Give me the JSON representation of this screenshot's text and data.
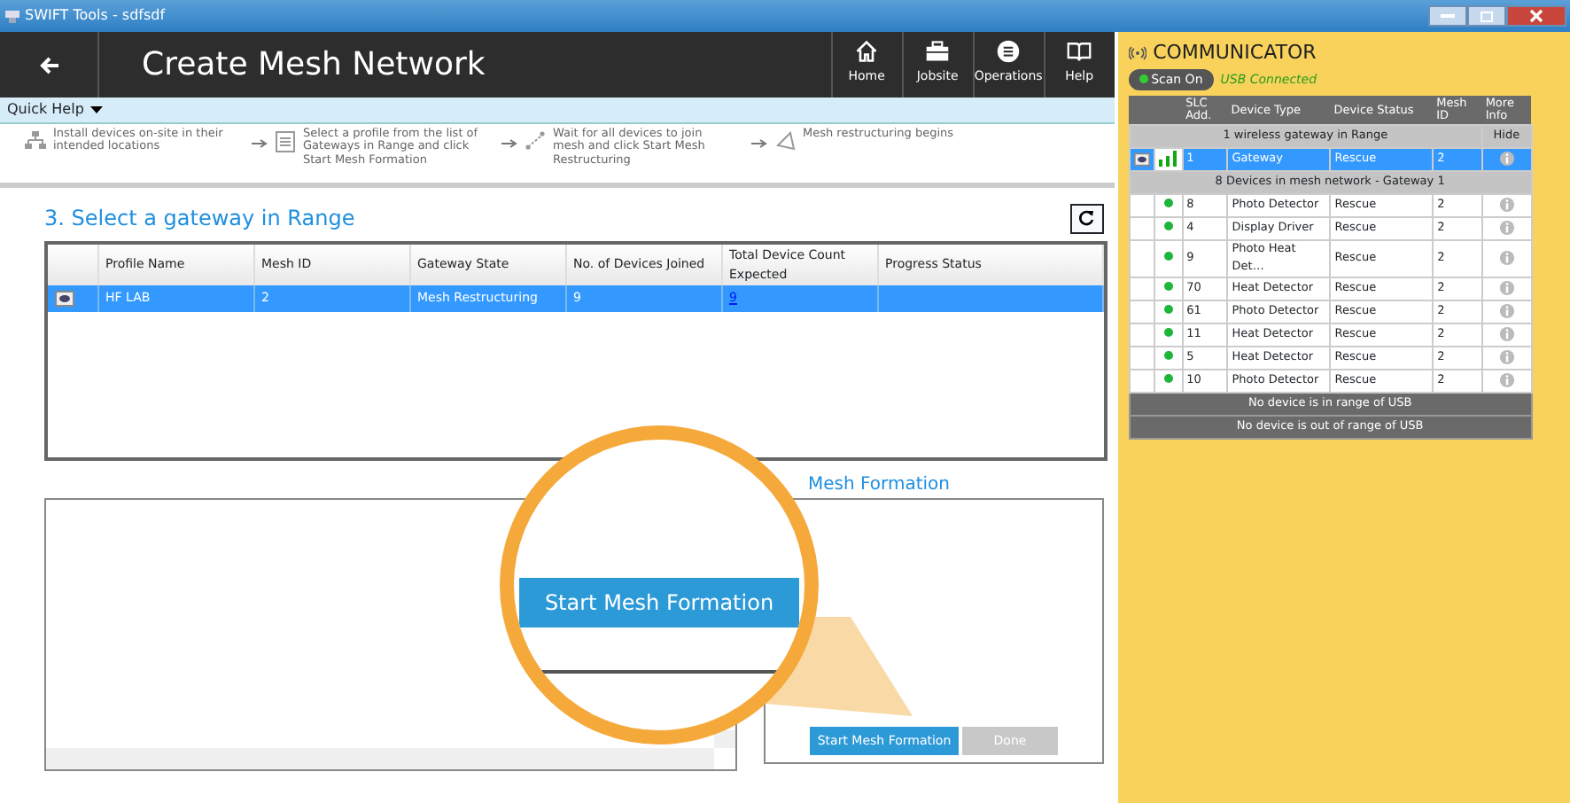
{
  "window": {
    "title": "SWIFT Tools - sdfsdf"
  },
  "header": {
    "title": "Create Mesh Network",
    "nav": [
      {
        "kind": "home",
        "label": "Home"
      },
      {
        "kind": "jobsite",
        "label": "Jobsite"
      },
      {
        "kind": "operations",
        "label": "Operations"
      },
      {
        "kind": "help",
        "label": "Help"
      }
    ]
  },
  "quick_help": {
    "label": "Quick Help",
    "steps": [
      {
        "kind": "devices",
        "text": "Install devices on-site in their intended locations"
      },
      {
        "kind": "list",
        "text": "Select a profile from the list of Gateways in Range and click Start Mesh Formation"
      },
      {
        "kind": "join",
        "text": "Wait for all devices to join mesh and click Start Mesh Restructuring"
      },
      {
        "kind": "mesh",
        "text": "Mesh restructuring begins"
      }
    ]
  },
  "gateway_section": {
    "title": "3. Select a gateway in Range",
    "table": {
      "columns": [
        "Profile Name",
        "Mesh ID",
        "Gateway State",
        "No. of Devices Joined",
        "Total Device Count Expected",
        "Progress Status"
      ],
      "rows": [
        {
          "selected": true,
          "profile_name": "HF LAB",
          "mesh_id": "2",
          "gateway_state": "Mesh Restructuring",
          "devices_joined": "9",
          "total_expected": "9"
        }
      ]
    }
  },
  "mesh_formation": {
    "title": "Mesh Formation",
    "buttons": [
      {
        "label": "Start Mesh Formation",
        "disabled": false
      },
      {
        "label": "Done",
        "disabled": true
      }
    ]
  },
  "magnifier": {
    "button_label": "Start Mesh Formation"
  },
  "communicator": {
    "title": "COMMUNICATOR",
    "scan_button": {
      "label": "Scan On",
      "on": true
    },
    "usb_status": "USB Connected",
    "columns": [
      "SLC Add.",
      "Device Type",
      "Device Status",
      "Mesh ID",
      "More Info"
    ],
    "gateway_group": "1 wireless gateway in Range",
    "hide_label": "Hide",
    "gateways": [
      {
        "selected": true,
        "slc": "1",
        "device_type": "Gateway",
        "status": "Rescue",
        "mesh_id": "2"
      }
    ],
    "device_group": "8 Devices in mesh network - Gateway 1",
    "devices": [
      {
        "online": true,
        "slc": "8",
        "device_type": "Photo Detector",
        "status": "Rescue",
        "mesh_id": "2"
      },
      {
        "online": true,
        "slc": "4",
        "device_type": "Display Driver",
        "status": "Rescue",
        "mesh_id": "2"
      },
      {
        "online": true,
        "slc": "9",
        "device_type": "Photo Heat Det…",
        "status": "Rescue",
        "mesh_id": "2"
      },
      {
        "online": true,
        "slc": "70",
        "device_type": "Heat Detector",
        "status": "Rescue",
        "mesh_id": "2"
      },
      {
        "online": true,
        "slc": "61",
        "device_type": "Photo Detector",
        "status": "Rescue",
        "mesh_id": "2"
      },
      {
        "online": true,
        "slc": "11",
        "device_type": "Heat Detector",
        "status": "Rescue",
        "mesh_id": "2"
      },
      {
        "online": true,
        "slc": "5",
        "device_type": "Heat Detector",
        "status": "Rescue",
        "mesh_id": "2"
      },
      {
        "online": true,
        "slc": "10",
        "device_type": "Photo Detector",
        "status": "Rescue",
        "mesh_id": "2"
      }
    ],
    "footer_rows": [
      "No device is in range of USB",
      "No device is out of range of USB"
    ]
  }
}
